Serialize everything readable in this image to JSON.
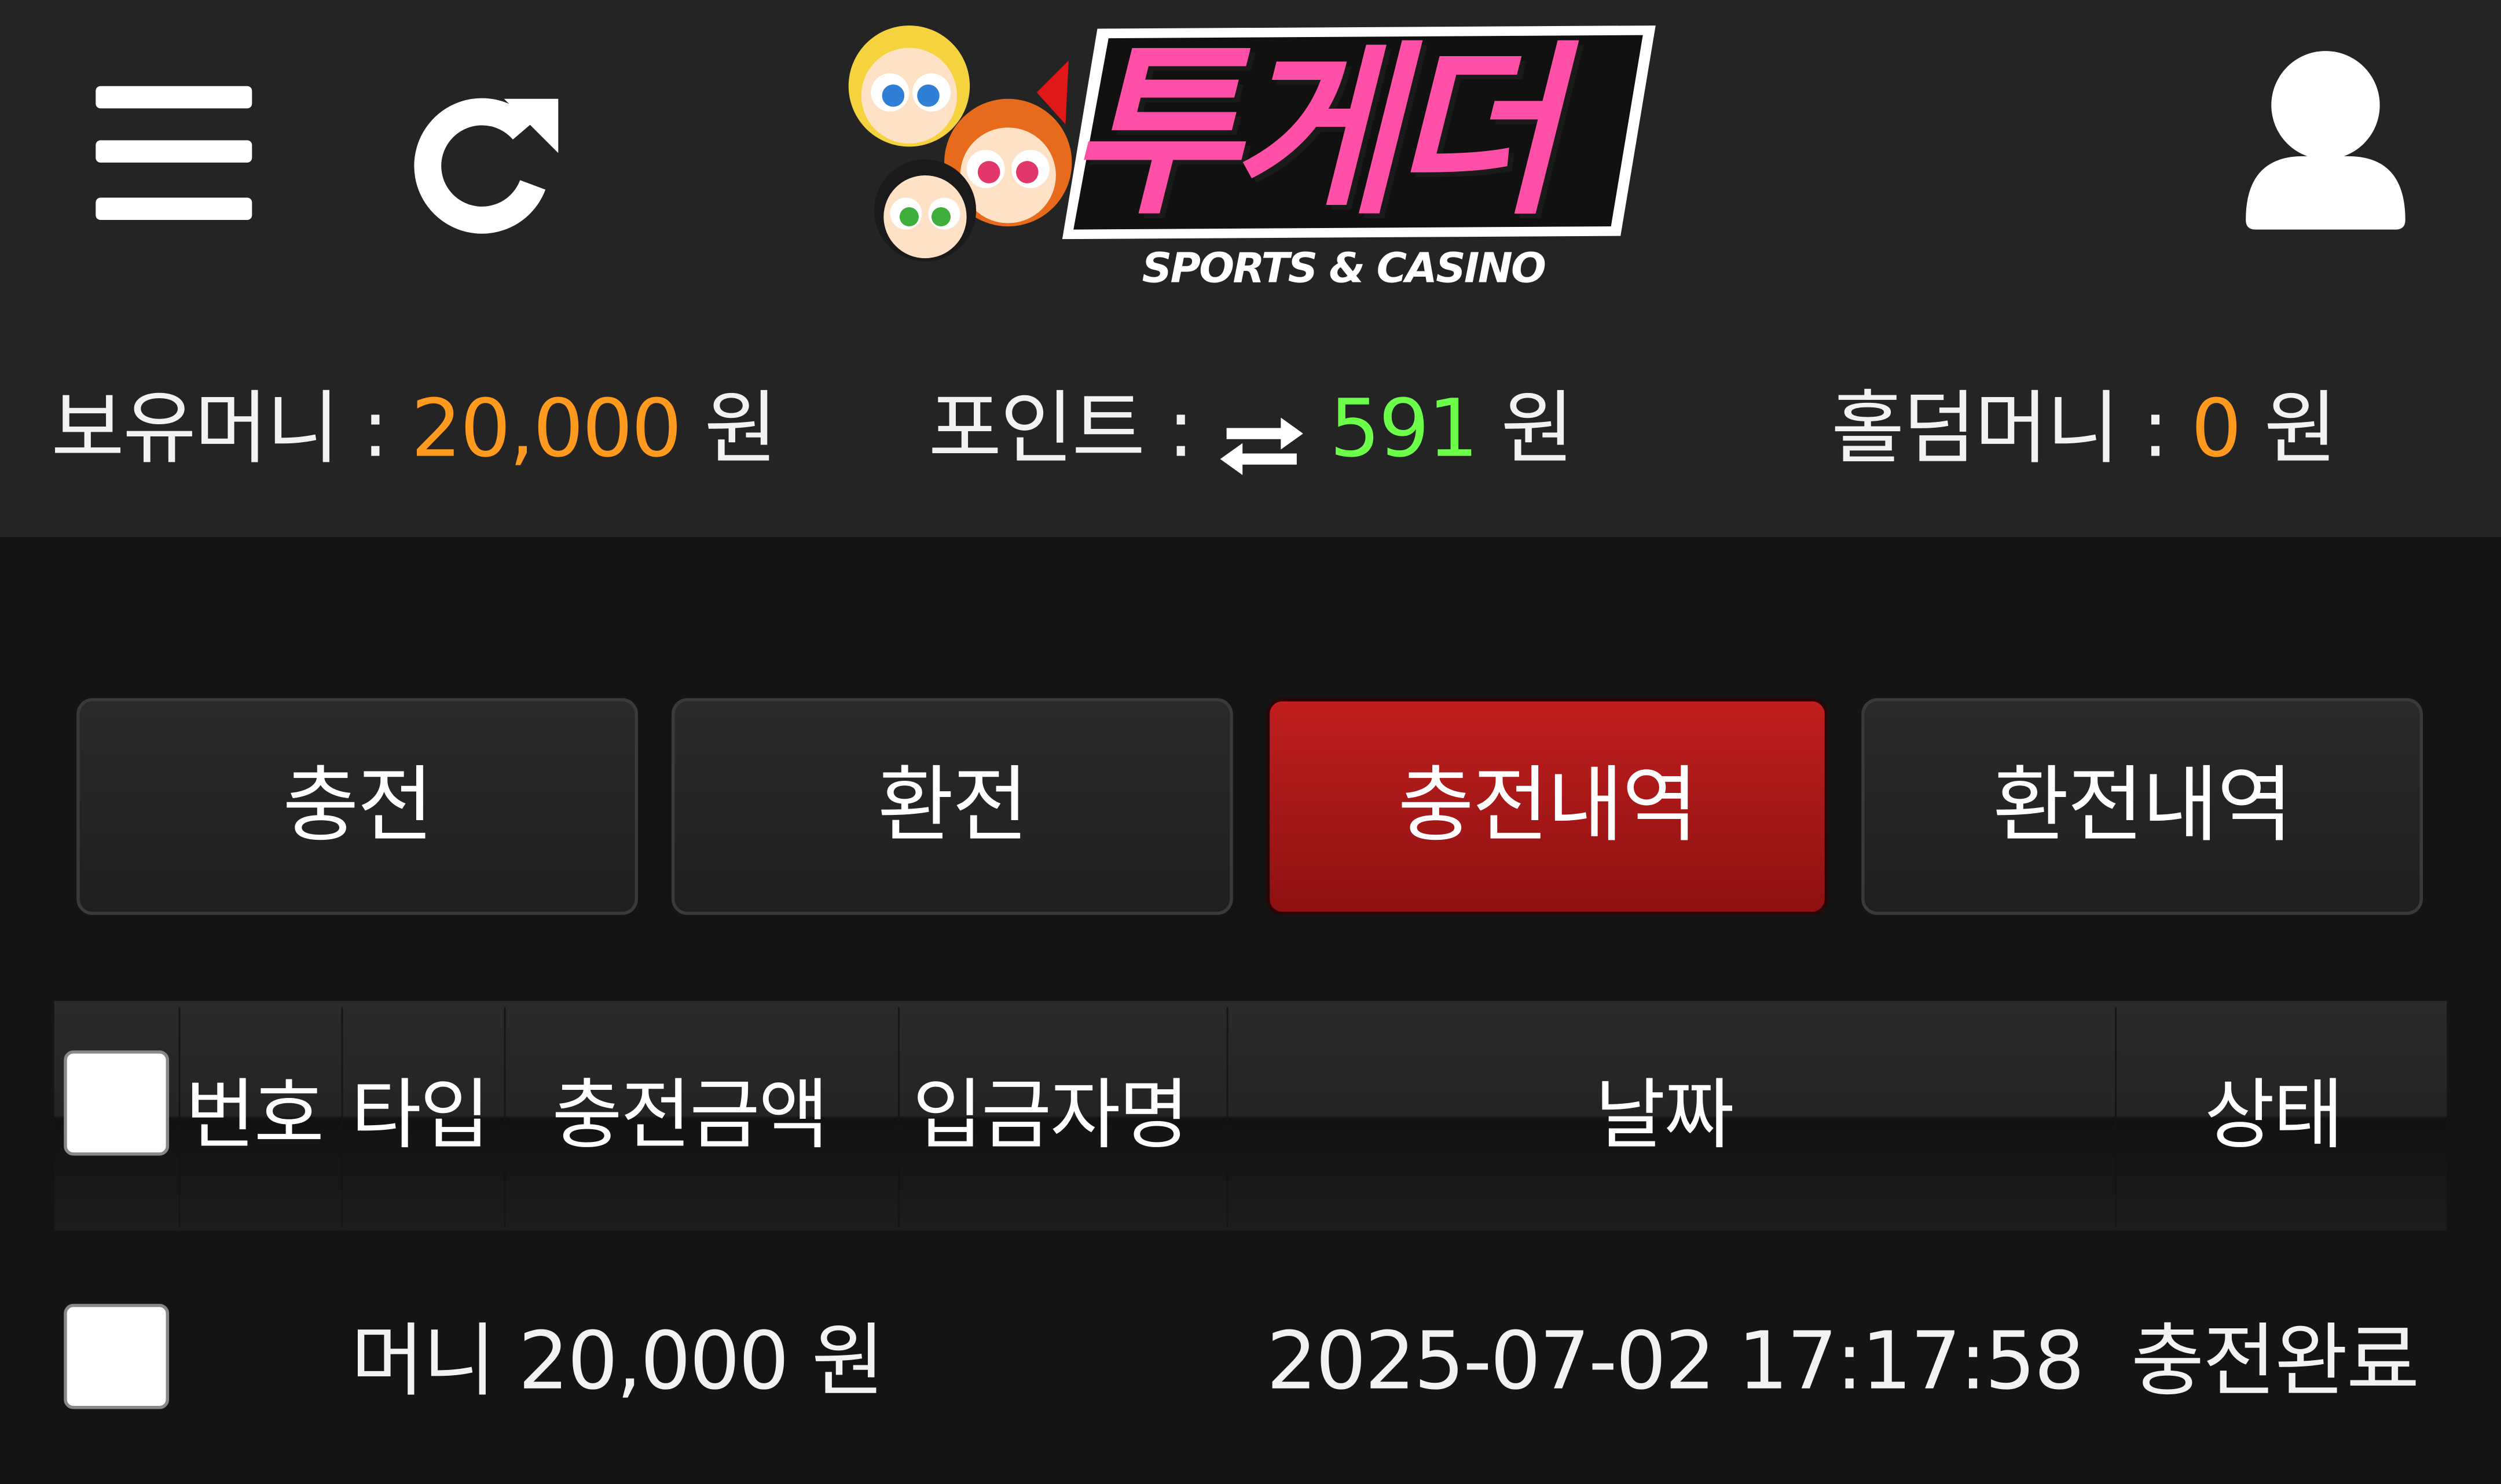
{
  "header": {
    "menu_icon": "hamburger-menu-icon",
    "refresh_icon": "refresh-icon",
    "user_icon": "user-icon",
    "logo": {
      "title": "투게더",
      "subtitle": "SPORTS & CASINO"
    }
  },
  "balances": {
    "money": {
      "label": "보유머니 :",
      "value": "20,000",
      "unit": "원",
      "color": "#ff9a1e"
    },
    "points": {
      "label": "포인트 :",
      "icon": "swap-arrows-icon",
      "value": "591",
      "unit": "원",
      "color": "#6cff49"
    },
    "holdem": {
      "label": "홀덤머니 :",
      "value": "0",
      "unit": "원",
      "color": "#ff9a1e"
    }
  },
  "tabs": [
    {
      "label": "충전",
      "active": false
    },
    {
      "label": "환전",
      "active": false
    },
    {
      "label": "충전내역",
      "active": true
    },
    {
      "label": "환전내역",
      "active": false
    }
  ],
  "table": {
    "headers": [
      "번호",
      "타입",
      "충전금액",
      "입금자명",
      "날짜",
      "상태"
    ],
    "rows": [
      {
        "checked": false,
        "type_amount": "머니 20,000 원",
        "date": "2025-07-02 17:17:58",
        "status": "충전완료"
      }
    ]
  },
  "colors": {
    "accent_red": "#b01a1a",
    "logo_pink": "#ff4fa6",
    "background": "#141414",
    "header_bg": "#242424"
  }
}
